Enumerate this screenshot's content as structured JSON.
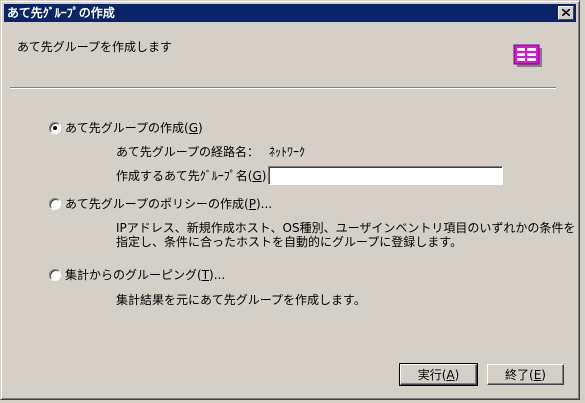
{
  "window": {
    "title": "あて先ｸﾞﾙｰﾌﾟの作成",
    "close_icon": "close-icon"
  },
  "header": {
    "text": "あて先グループを作成します",
    "icon": "group-list-icon"
  },
  "options": {
    "create_group": {
      "label": "あて先グループの作成(G)",
      "selected": true,
      "route_label": "あて先グループの経路名：",
      "route_value": "ﾈｯﾄﾜｰｸ",
      "name_label": "作成するあて先ｸﾞﾙｰﾌﾟ名(G):",
      "name_value": ""
    },
    "create_policy": {
      "label": "あて先グループのポリシーの作成(P)...",
      "selected": false,
      "description": [
        "IPアドレス、新規作成ホスト、OS種別、ユーザインベントリ項目のいずれかの条件を",
        "指定し、条件に合ったホストを自動的にグループに登録します。"
      ]
    },
    "group_from_aggregate": {
      "label": "集計からのグルーピング(T)...",
      "selected": false,
      "description": [
        "集計結果を元にあて先グループを作成します。"
      ]
    }
  },
  "buttons": {
    "execute": "実行(A)",
    "exit": "終了(E)"
  },
  "colors": {
    "title_bar": "#0a246a",
    "face": "#d4d0c8",
    "icon": "#e010e0"
  }
}
